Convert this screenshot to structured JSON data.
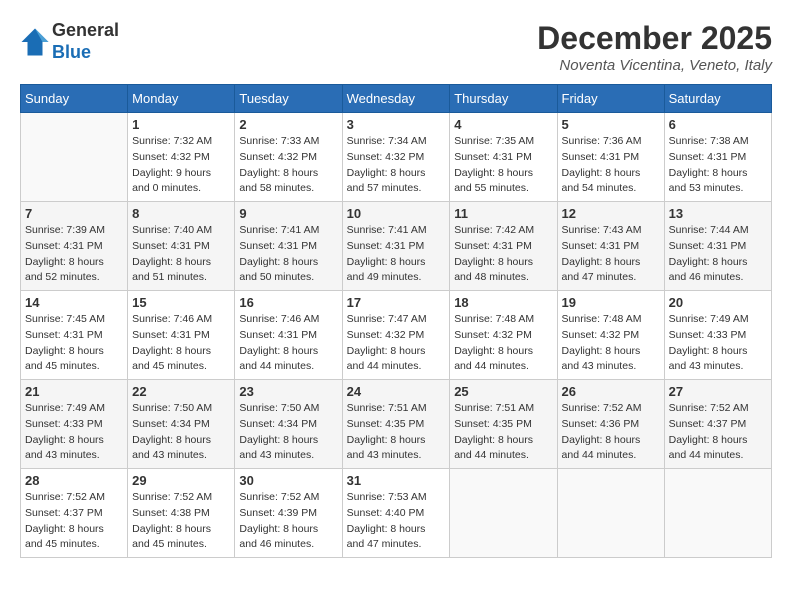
{
  "header": {
    "logo_line1": "General",
    "logo_line2": "Blue",
    "month_title": "December 2025",
    "location": "Noventa Vicentina, Veneto, Italy"
  },
  "weekdays": [
    "Sunday",
    "Monday",
    "Tuesday",
    "Wednesday",
    "Thursday",
    "Friday",
    "Saturday"
  ],
  "weeks": [
    [
      {
        "day": "",
        "info": ""
      },
      {
        "day": "1",
        "info": "Sunrise: 7:32 AM\nSunset: 4:32 PM\nDaylight: 9 hours\nand 0 minutes."
      },
      {
        "day": "2",
        "info": "Sunrise: 7:33 AM\nSunset: 4:32 PM\nDaylight: 8 hours\nand 58 minutes."
      },
      {
        "day": "3",
        "info": "Sunrise: 7:34 AM\nSunset: 4:32 PM\nDaylight: 8 hours\nand 57 minutes."
      },
      {
        "day": "4",
        "info": "Sunrise: 7:35 AM\nSunset: 4:31 PM\nDaylight: 8 hours\nand 55 minutes."
      },
      {
        "day": "5",
        "info": "Sunrise: 7:36 AM\nSunset: 4:31 PM\nDaylight: 8 hours\nand 54 minutes."
      },
      {
        "day": "6",
        "info": "Sunrise: 7:38 AM\nSunset: 4:31 PM\nDaylight: 8 hours\nand 53 minutes."
      }
    ],
    [
      {
        "day": "7",
        "info": "Sunrise: 7:39 AM\nSunset: 4:31 PM\nDaylight: 8 hours\nand 52 minutes."
      },
      {
        "day": "8",
        "info": "Sunrise: 7:40 AM\nSunset: 4:31 PM\nDaylight: 8 hours\nand 51 minutes."
      },
      {
        "day": "9",
        "info": "Sunrise: 7:41 AM\nSunset: 4:31 PM\nDaylight: 8 hours\nand 50 minutes."
      },
      {
        "day": "10",
        "info": "Sunrise: 7:41 AM\nSunset: 4:31 PM\nDaylight: 8 hours\nand 49 minutes."
      },
      {
        "day": "11",
        "info": "Sunrise: 7:42 AM\nSunset: 4:31 PM\nDaylight: 8 hours\nand 48 minutes."
      },
      {
        "day": "12",
        "info": "Sunrise: 7:43 AM\nSunset: 4:31 PM\nDaylight: 8 hours\nand 47 minutes."
      },
      {
        "day": "13",
        "info": "Sunrise: 7:44 AM\nSunset: 4:31 PM\nDaylight: 8 hours\nand 46 minutes."
      }
    ],
    [
      {
        "day": "14",
        "info": "Sunrise: 7:45 AM\nSunset: 4:31 PM\nDaylight: 8 hours\nand 45 minutes."
      },
      {
        "day": "15",
        "info": "Sunrise: 7:46 AM\nSunset: 4:31 PM\nDaylight: 8 hours\nand 45 minutes."
      },
      {
        "day": "16",
        "info": "Sunrise: 7:46 AM\nSunset: 4:31 PM\nDaylight: 8 hours\nand 44 minutes."
      },
      {
        "day": "17",
        "info": "Sunrise: 7:47 AM\nSunset: 4:32 PM\nDaylight: 8 hours\nand 44 minutes."
      },
      {
        "day": "18",
        "info": "Sunrise: 7:48 AM\nSunset: 4:32 PM\nDaylight: 8 hours\nand 44 minutes."
      },
      {
        "day": "19",
        "info": "Sunrise: 7:48 AM\nSunset: 4:32 PM\nDaylight: 8 hours\nand 43 minutes."
      },
      {
        "day": "20",
        "info": "Sunrise: 7:49 AM\nSunset: 4:33 PM\nDaylight: 8 hours\nand 43 minutes."
      }
    ],
    [
      {
        "day": "21",
        "info": "Sunrise: 7:49 AM\nSunset: 4:33 PM\nDaylight: 8 hours\nand 43 minutes."
      },
      {
        "day": "22",
        "info": "Sunrise: 7:50 AM\nSunset: 4:34 PM\nDaylight: 8 hours\nand 43 minutes."
      },
      {
        "day": "23",
        "info": "Sunrise: 7:50 AM\nSunset: 4:34 PM\nDaylight: 8 hours\nand 43 minutes."
      },
      {
        "day": "24",
        "info": "Sunrise: 7:51 AM\nSunset: 4:35 PM\nDaylight: 8 hours\nand 43 minutes."
      },
      {
        "day": "25",
        "info": "Sunrise: 7:51 AM\nSunset: 4:35 PM\nDaylight: 8 hours\nand 44 minutes."
      },
      {
        "day": "26",
        "info": "Sunrise: 7:52 AM\nSunset: 4:36 PM\nDaylight: 8 hours\nand 44 minutes."
      },
      {
        "day": "27",
        "info": "Sunrise: 7:52 AM\nSunset: 4:37 PM\nDaylight: 8 hours\nand 44 minutes."
      }
    ],
    [
      {
        "day": "28",
        "info": "Sunrise: 7:52 AM\nSunset: 4:37 PM\nDaylight: 8 hours\nand 45 minutes."
      },
      {
        "day": "29",
        "info": "Sunrise: 7:52 AM\nSunset: 4:38 PM\nDaylight: 8 hours\nand 45 minutes."
      },
      {
        "day": "30",
        "info": "Sunrise: 7:52 AM\nSunset: 4:39 PM\nDaylight: 8 hours\nand 46 minutes."
      },
      {
        "day": "31",
        "info": "Sunrise: 7:53 AM\nSunset: 4:40 PM\nDaylight: 8 hours\nand 47 minutes."
      },
      {
        "day": "",
        "info": ""
      },
      {
        "day": "",
        "info": ""
      },
      {
        "day": "",
        "info": ""
      }
    ]
  ]
}
